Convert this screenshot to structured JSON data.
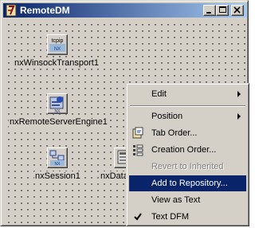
{
  "window": {
    "title": "RemoteDM"
  },
  "components": [
    {
      "label": "nxWinsockTransport1",
      "icon": "tcpip-transport-icon",
      "icon_text": "tcpip"
    },
    {
      "label": "nxRemoteServerEngine1",
      "icon": "remote-server-engine-icon"
    },
    {
      "label": "nxSession1",
      "icon": "session-icon"
    },
    {
      "label": "nxData",
      "icon": "database-icon"
    }
  ],
  "context_menu": {
    "items": [
      {
        "label": "Edit",
        "submenu": true
      },
      {
        "label": "Position",
        "submenu": true
      },
      {
        "label": "Tab Order...",
        "icon": "tab-order-icon"
      },
      {
        "label": "Creation Order...",
        "icon": "creation-order-icon"
      },
      {
        "label": "Revert to Inherited",
        "disabled": true
      },
      {
        "label": "Add to Repository...",
        "highlighted": true
      },
      {
        "label": "View as Text"
      },
      {
        "label": "Text DFM",
        "checked": true
      }
    ]
  },
  "colors": {
    "face": "#d4d0c8",
    "titlebar_start": "#0a246a",
    "titlebar_end": "#a6caf0",
    "highlight": "#0a246a"
  }
}
